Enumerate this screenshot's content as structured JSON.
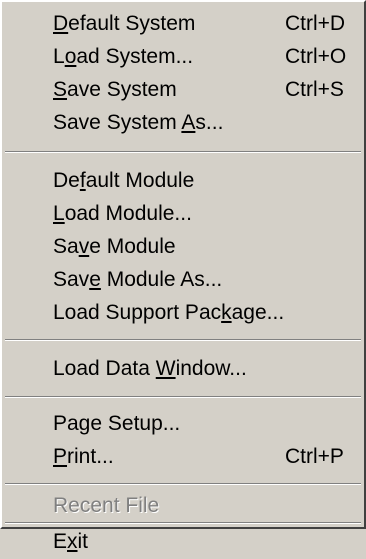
{
  "menu": {
    "items": [
      {
        "label": "Default System",
        "mnemonic": "D",
        "shortcut": "Ctrl+D",
        "enabled": true
      },
      {
        "label": "Load System...",
        "mnemonic": "o",
        "shortcut": "Ctrl+O",
        "enabled": true
      },
      {
        "label": "Save System",
        "mnemonic": "S",
        "shortcut": "Ctrl+S",
        "enabled": true
      },
      {
        "label": "Save System As...",
        "mnemonic": "A",
        "shortcut": "",
        "enabled": true
      },
      {
        "label": "Default Module",
        "mnemonic": "f",
        "shortcut": "",
        "enabled": true
      },
      {
        "label": "Load Module...",
        "mnemonic": "L",
        "shortcut": "",
        "enabled": true
      },
      {
        "label": "Save Module",
        "mnemonic": "v",
        "shortcut": "",
        "enabled": true
      },
      {
        "label": "Save Module As...",
        "mnemonic": "e",
        "shortcut": "",
        "enabled": true
      },
      {
        "label": "Load Support Package...",
        "mnemonic": "k",
        "shortcut": "",
        "enabled": true
      },
      {
        "label": "Load Data Window...",
        "mnemonic": "W",
        "shortcut": "",
        "enabled": true
      },
      {
        "label": "Page Setup...",
        "mnemonic": "",
        "shortcut": "",
        "enabled": true
      },
      {
        "label": "Print...",
        "mnemonic": "P",
        "shortcut": "Ctrl+P",
        "enabled": true
      },
      {
        "label": "Recent File",
        "mnemonic": "",
        "shortcut": "",
        "enabled": false
      },
      {
        "label": "Exit",
        "mnemonic": "x",
        "shortcut": "",
        "enabled": true
      }
    ]
  }
}
